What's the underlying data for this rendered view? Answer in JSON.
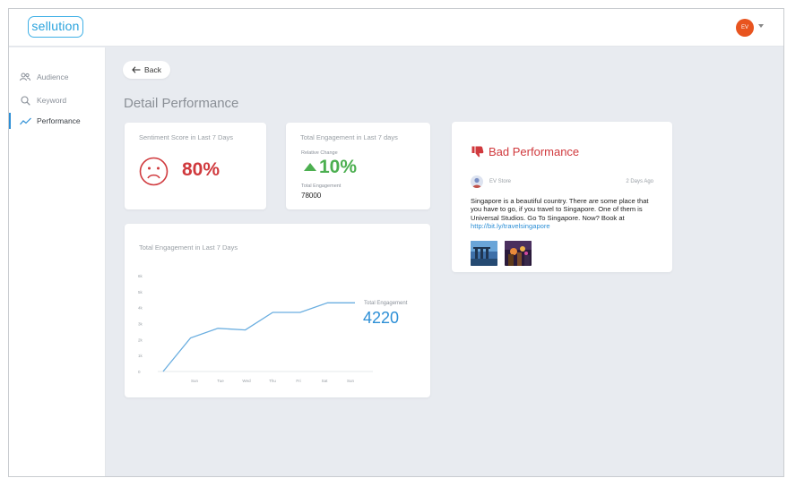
{
  "app": {
    "logo_text": "sellution"
  },
  "user": {
    "initials": "EV"
  },
  "sidebar": {
    "items": [
      {
        "label": "Audience",
        "icon": "audience-icon"
      },
      {
        "label": "Keyword",
        "icon": "search-icon"
      },
      {
        "label": "Performance",
        "icon": "trend-icon",
        "active": true
      }
    ]
  },
  "back_label": "Back",
  "page_title": "Detail Performance",
  "sentiment_card": {
    "label": "Sentiment Score in Last 7 Days",
    "value": "80%",
    "icon": "sad-face-icon",
    "color": "#d0393d"
  },
  "engagement_card": {
    "label": "Total Engagement in Last 7 days",
    "relative_label": "Relative Change",
    "relative_value": "10%",
    "trend": "up",
    "total_label": "Total Engagement",
    "total_value": "78000",
    "color": "#4caf50"
  },
  "chart_card": {
    "label": "Total Engagement in Last 7 Days",
    "legend_label": "Total Engagement",
    "legend_value": "4220"
  },
  "chart_data": {
    "type": "line",
    "x": [
      "Sun",
      "Tue",
      "Wed",
      "Thu",
      "Fri",
      "Sat",
      "Sun"
    ],
    "y_ticks": [
      "0",
      "1k",
      "2k",
      "3k",
      "4k",
      "5k",
      "6k"
    ],
    "ylim": [
      0,
      6
    ],
    "series": [
      {
        "values": [
          0,
          2.1,
          2.7,
          2.6,
          3.7,
          3.7,
          4.3,
          4.3
        ]
      }
    ],
    "line_color": "#6aaee0"
  },
  "bad_card": {
    "title": "Bad Performance",
    "icon": "thumbs-down-icon",
    "user": "EV Store",
    "time": "2 Days Ago",
    "text": "Singapore is a beautiful country. There are some place that you have to go, if you travel to Singapore. One of them is Universal Studios. Go To Singapore. Now? Book at ",
    "link": "http://bit.ly/travelsingapore",
    "color": "#d0393d"
  }
}
